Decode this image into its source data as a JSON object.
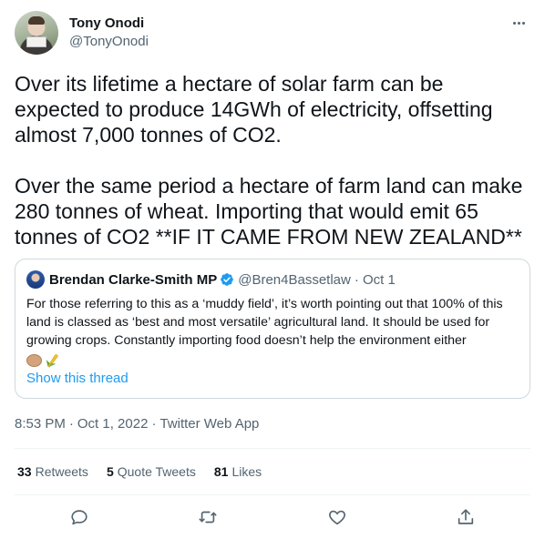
{
  "author": {
    "name": "Tony Onodi",
    "handle": "@TonyOnodi"
  },
  "tweet": {
    "text": "Over its lifetime a hectare of solar farm can be expected to produce 14GWh of electricity, offsetting almost 7,000 tonnes of CO2.\n\nOver the same period a hectare of farm land can make 280 tonnes of wheat. Importing that would emit 65 tonnes of CO2 **IF IT CAME FROM NEW ZEALAND**",
    "time": "8:53 PM",
    "date": "Oct 1, 2022",
    "source": "Twitter Web App",
    "separator": "·"
  },
  "quoted": {
    "name": "Brendan Clarke-Smith MP",
    "handle": "@Bren4Bassetlaw",
    "date_sep": "· Oct 1",
    "text": "For those referring to this as a ‘muddy field’, it’s worth pointing out that 100% of this land is classed as  ‘best and most versatile’ agricultural land. It should be used for growing crops. Constantly importing food doesn’t help the environment either",
    "show_thread": "Show this thread",
    "emojis": [
      "potato-emoji",
      "corn-emoji"
    ]
  },
  "stats": {
    "retweets_count": "33",
    "retweets_label": "Retweets",
    "quotes_count": "5",
    "quotes_label": "Quote Tweets",
    "likes_count": "81",
    "likes_label": "Likes"
  },
  "icons": {
    "reply": "reply-icon",
    "retweet": "retweet-icon",
    "like": "heart-icon",
    "share": "share-icon",
    "more": "more-icon",
    "verified": "verified-badge-icon"
  },
  "colors": {
    "link": "#1d9bf0",
    "secondary_text": "#536471",
    "border": "#cfd9de"
  }
}
